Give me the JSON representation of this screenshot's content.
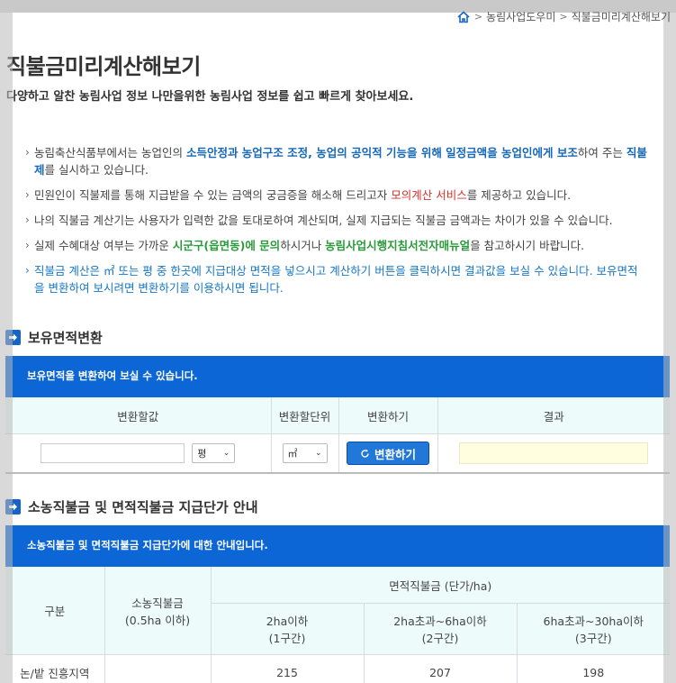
{
  "breadcrumb": {
    "home_icon": "home-icon",
    "item1": "농림사업도우미",
    "item2": "직불금미리계산해보기"
  },
  "header": {
    "title": "직불금미리계산해보기",
    "subtitle": "다양하고 알찬 농림사업 정보 나만을위한 농림사업 정보를 쉽고 빠르게 찾아보세요."
  },
  "info": {
    "l1a": "농림축산식품부에서는 농업인의 ",
    "l1b": "소득안정과 농업구조 조정, 농업의 공익적 기능을 위해 일정금액을 농업인에게 보조",
    "l1c": "하여 주는 ",
    "l1d": "직불제",
    "l1e": "를 실시하고 있습니다.",
    "l2a": "민원인이 직불제를 통해 지급받을 수 있는 금액의 궁금증을 해소해 드리고자 ",
    "l2b": "모의계산 서비스",
    "l2c": "를 제공하고 있습니다.",
    "l3": "나의 직불금 계산기는 사용자가 입력한 값을 토대로하여 계산되며, 실제 지급되는 직불금 금액과는 차이가 있을 수 있습니다.",
    "l4a": "실제 수혜대상 여부는 가까운 ",
    "l4b": "시군구(읍면동)에 문의",
    "l4c": "하시거나 ",
    "l4d": "농림사업시행지침서전자매뉴얼",
    "l4e": "을 참고하시기 바랍니다.",
    "l5": "직불금 계산은 ㎡ 또는 평 중 한곳에 지급대상 면적을 넣으시고 계산하기 버튼을 클릭하시면 결과값을 보실 수 있습니다. 보유면적을 변환하여 보시려면 변환하기를 이용하시면 됩니다."
  },
  "convert": {
    "heading": "보유면적변환",
    "bar": "보유면적을 변환하여 보실 수 있습니다.",
    "cols": [
      "변환할값",
      "변환할단위",
      "변환하기",
      "결과"
    ],
    "input_value": "",
    "unit_from": "평",
    "unit_to": "㎡",
    "button": "변환하기",
    "result": ""
  },
  "rates": {
    "heading": "소농직불금 및 면적직불금 지급단가 안내",
    "bar": "소농직불금 및 면적직불금 지급단가에 대한 안내입니다.",
    "col_category": "구분",
    "col_small_1": "소농직불금",
    "col_small_2": "(0.5ha 이하)",
    "col_area": "면적직불금 (단가/ha)",
    "tier1_a": "2ha이하",
    "tier1_b": "(1구간)",
    "tier2_a": "2ha초과~6ha이하",
    "tier2_b": "(2구간)",
    "tier3_a": "6ha초과~30ha이하",
    "tier3_b": "(3구간)",
    "row1": {
      "label": "논/밭 진흥지역",
      "small": "",
      "t1": "215",
      "t2": "207",
      "t3": "198"
    }
  },
  "colors": {
    "accent": "#0c66d6",
    "red": "#d8302b",
    "green": "#2a9a3a",
    "result_bg": "#ffffe0"
  }
}
